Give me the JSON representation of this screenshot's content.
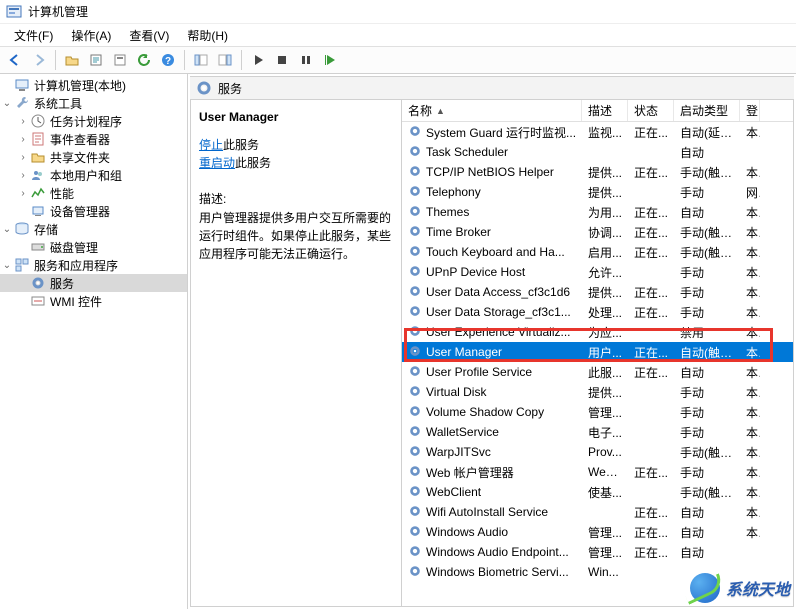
{
  "title": "计算机管理",
  "menu": {
    "items": [
      "文件(F)",
      "操作(A)",
      "查看(V)",
      "帮助(H)"
    ]
  },
  "toolbar": [
    {
      "name": "back-icon"
    },
    {
      "name": "forward-icon"
    },
    {
      "sep": true
    },
    {
      "name": "folder-open-icon"
    },
    {
      "name": "export-list-icon"
    },
    {
      "name": "properties-icon"
    },
    {
      "name": "refresh-icon"
    },
    {
      "name": "help-icon"
    },
    {
      "sep": true
    },
    {
      "name": "show-hide-tree-icon"
    },
    {
      "name": "show-hide-pane-icon"
    },
    {
      "sep": true
    },
    {
      "name": "play-black-icon"
    },
    {
      "name": "stop-icon"
    },
    {
      "name": "pause-icon"
    },
    {
      "name": "play-green-icon"
    }
  ],
  "tree": {
    "root": "计算机管理(本地)",
    "nodes": [
      {
        "label": "系统工具",
        "icon": "wrench-icon",
        "expanded": true,
        "children": [
          {
            "label": "任务计划程序",
            "icon": "clock-icon",
            "expandable": true
          },
          {
            "label": "事件查看器",
            "icon": "event-icon",
            "expandable": true
          },
          {
            "label": "共享文件夹",
            "icon": "share-icon",
            "expandable": true
          },
          {
            "label": "本地用户和组",
            "icon": "users-icon",
            "expandable": true
          },
          {
            "label": "性能",
            "icon": "perf-icon",
            "expandable": true
          },
          {
            "label": "设备管理器",
            "icon": "device-icon",
            "expandable": false
          }
        ]
      },
      {
        "label": "存储",
        "icon": "storage-icon",
        "expanded": true,
        "children": [
          {
            "label": "磁盘管理",
            "icon": "disk-icon",
            "expandable": false
          }
        ]
      },
      {
        "label": "服务和应用程序",
        "icon": "services-app-icon",
        "expanded": true,
        "children": [
          {
            "label": "服务",
            "icon": "gear-icon",
            "expandable": false,
            "selected": true
          },
          {
            "label": "WMI 控件",
            "icon": "wmi-icon",
            "expandable": false
          }
        ]
      }
    ]
  },
  "category_header": "服务",
  "detail": {
    "title": "User Manager",
    "stop_label": "停止",
    "stop_suffix": "此服务",
    "restart_label": "重启动",
    "restart_suffix": "此服务",
    "desc_label": "描述:",
    "desc": "用户管理器提供多用户交互所需要的运行时组件。如果停止此服务，某些应用程序可能无法正确运行。"
  },
  "columns": [
    "名称",
    "描述",
    "状态",
    "启动类型",
    "登"
  ],
  "services": [
    {
      "name": "System Guard 运行时监视...",
      "desc": "监视...",
      "state": "正在...",
      "start": "自动(延迟...",
      "log": "本"
    },
    {
      "name": "Task Scheduler",
      "desc": "",
      "state": "",
      "start": "自动",
      "log": ""
    },
    {
      "name": "TCP/IP NetBIOS Helper",
      "desc": "提供...",
      "state": "正在...",
      "start": "手动(触发...",
      "log": "本"
    },
    {
      "name": "Telephony",
      "desc": "提供...",
      "state": "",
      "start": "手动",
      "log": "网"
    },
    {
      "name": "Themes",
      "desc": "为用...",
      "state": "正在...",
      "start": "自动",
      "log": "本"
    },
    {
      "name": "Time Broker",
      "desc": "协调...",
      "state": "正在...",
      "start": "手动(触发...",
      "log": "本"
    },
    {
      "name": "Touch Keyboard and Ha...",
      "desc": "启用...",
      "state": "正在...",
      "start": "手动(触发...",
      "log": "本"
    },
    {
      "name": "UPnP Device Host",
      "desc": "允许...",
      "state": "",
      "start": "手动",
      "log": "本"
    },
    {
      "name": "User Data Access_cf3c1d6",
      "desc": "提供...",
      "state": "正在...",
      "start": "手动",
      "log": "本"
    },
    {
      "name": "User Data Storage_cf3c1...",
      "desc": "处理...",
      "state": "正在...",
      "start": "手动",
      "log": "本"
    },
    {
      "name": "User Experience Virtualiz...",
      "desc": "为应...",
      "state": "",
      "start": "禁用",
      "log": "本"
    },
    {
      "name": "User Manager",
      "desc": "用户...",
      "state": "正在...",
      "start": "自动(触发...",
      "log": "本",
      "selected": true
    },
    {
      "name": "User Profile Service",
      "desc": "此服...",
      "state": "正在...",
      "start": "自动",
      "log": "本"
    },
    {
      "name": "Virtual Disk",
      "desc": "提供...",
      "state": "",
      "start": "手动",
      "log": "本"
    },
    {
      "name": "Volume Shadow Copy",
      "desc": "管理...",
      "state": "",
      "start": "手动",
      "log": "本"
    },
    {
      "name": "WalletService",
      "desc": "电子...",
      "state": "",
      "start": "手动",
      "log": "本"
    },
    {
      "name": "WarpJITSvc",
      "desc": "Prov...",
      "state": "",
      "start": "手动(触发...",
      "log": "本"
    },
    {
      "name": "Web 帐户管理器",
      "desc": "Web...",
      "state": "正在...",
      "start": "手动",
      "log": "本"
    },
    {
      "name": "WebClient",
      "desc": "使基...",
      "state": "",
      "start": "手动(触发...",
      "log": "本"
    },
    {
      "name": "Wifi AutoInstall Service",
      "desc": "",
      "state": "正在...",
      "start": "自动",
      "log": "本"
    },
    {
      "name": "Windows Audio",
      "desc": "管理...",
      "state": "正在...",
      "start": "自动",
      "log": "本"
    },
    {
      "name": "Windows Audio Endpoint...",
      "desc": "管理...",
      "state": "正在...",
      "start": "自动",
      "log": ""
    },
    {
      "name": "Windows Biometric Servi...",
      "desc": "Win...",
      "state": "",
      "start": "",
      "log": ""
    }
  ],
  "watermark": "系统天地"
}
